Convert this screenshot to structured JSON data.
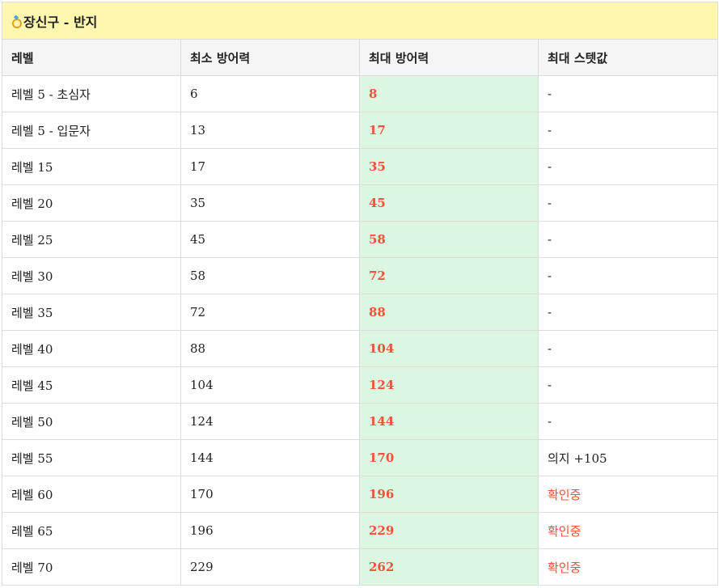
{
  "title": "장신구 - 반지",
  "colors": {
    "title_bg": "#fff7b0",
    "header_bg": "#f5f5f5",
    "max_col_bg": "#dbf6e1",
    "accent": "#f0533a"
  },
  "columns": [
    "레벨",
    "최소 방어력",
    "최대 방어력",
    "최대 스텟값"
  ],
  "rows": [
    {
      "level": "레벨 5 - 초심자",
      "min": "6",
      "max": "8",
      "stat": "-"
    },
    {
      "level": "레벨 5 - 입문자",
      "min": "13",
      "max": "17",
      "stat": "-"
    },
    {
      "level": "레벨 15",
      "min": "17",
      "max": "35",
      "stat": "-"
    },
    {
      "level": "레벨 20",
      "min": "35",
      "max": "45",
      "stat": "-"
    },
    {
      "level": "레벨 25",
      "min": "45",
      "max": "58",
      "stat": "-"
    },
    {
      "level": "레벨 30",
      "min": "58",
      "max": "72",
      "stat": "-"
    },
    {
      "level": "레벨 35",
      "min": "72",
      "max": "88",
      "stat": "-"
    },
    {
      "level": "레벨 40",
      "min": "88",
      "max": "104",
      "stat": "-"
    },
    {
      "level": "레벨 45",
      "min": "104",
      "max": "124",
      "stat": "-"
    },
    {
      "level": "레벨 50",
      "min": "124",
      "max": "144",
      "stat": "-"
    },
    {
      "level": "레벨 55",
      "min": "144",
      "max": "170",
      "stat": "의지 +105"
    },
    {
      "level": "레벨 60",
      "min": "170",
      "max": "196",
      "stat": "확인중",
      "pending": true
    },
    {
      "level": "레벨 65",
      "min": "196",
      "max": "229",
      "stat": "확인중",
      "pending": true
    },
    {
      "level": "레벨 70",
      "min": "229",
      "max": "262",
      "stat": "확인중",
      "pending": true
    }
  ]
}
